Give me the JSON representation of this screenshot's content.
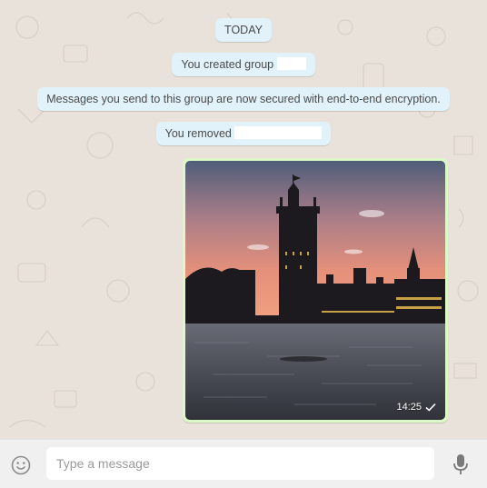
{
  "messages": {
    "date_label": "TODAY",
    "created_group": "You created group",
    "encryption_notice": "Messages you send to this group are now secured with end-to-end encryption.",
    "removed": "You removed"
  },
  "image_message": {
    "time": "14:25",
    "status_icon": "single-check-icon"
  },
  "composer": {
    "placeholder": "Type a message",
    "emoji_icon": "smiley-icon",
    "mic_icon": "microphone-icon"
  },
  "colors": {
    "chat_background": "#e8e2da",
    "system_bubble": "#e1f2fa",
    "outgoing_bubble": "#dcf8c6",
    "composer_bar": "#f0f0f0"
  }
}
